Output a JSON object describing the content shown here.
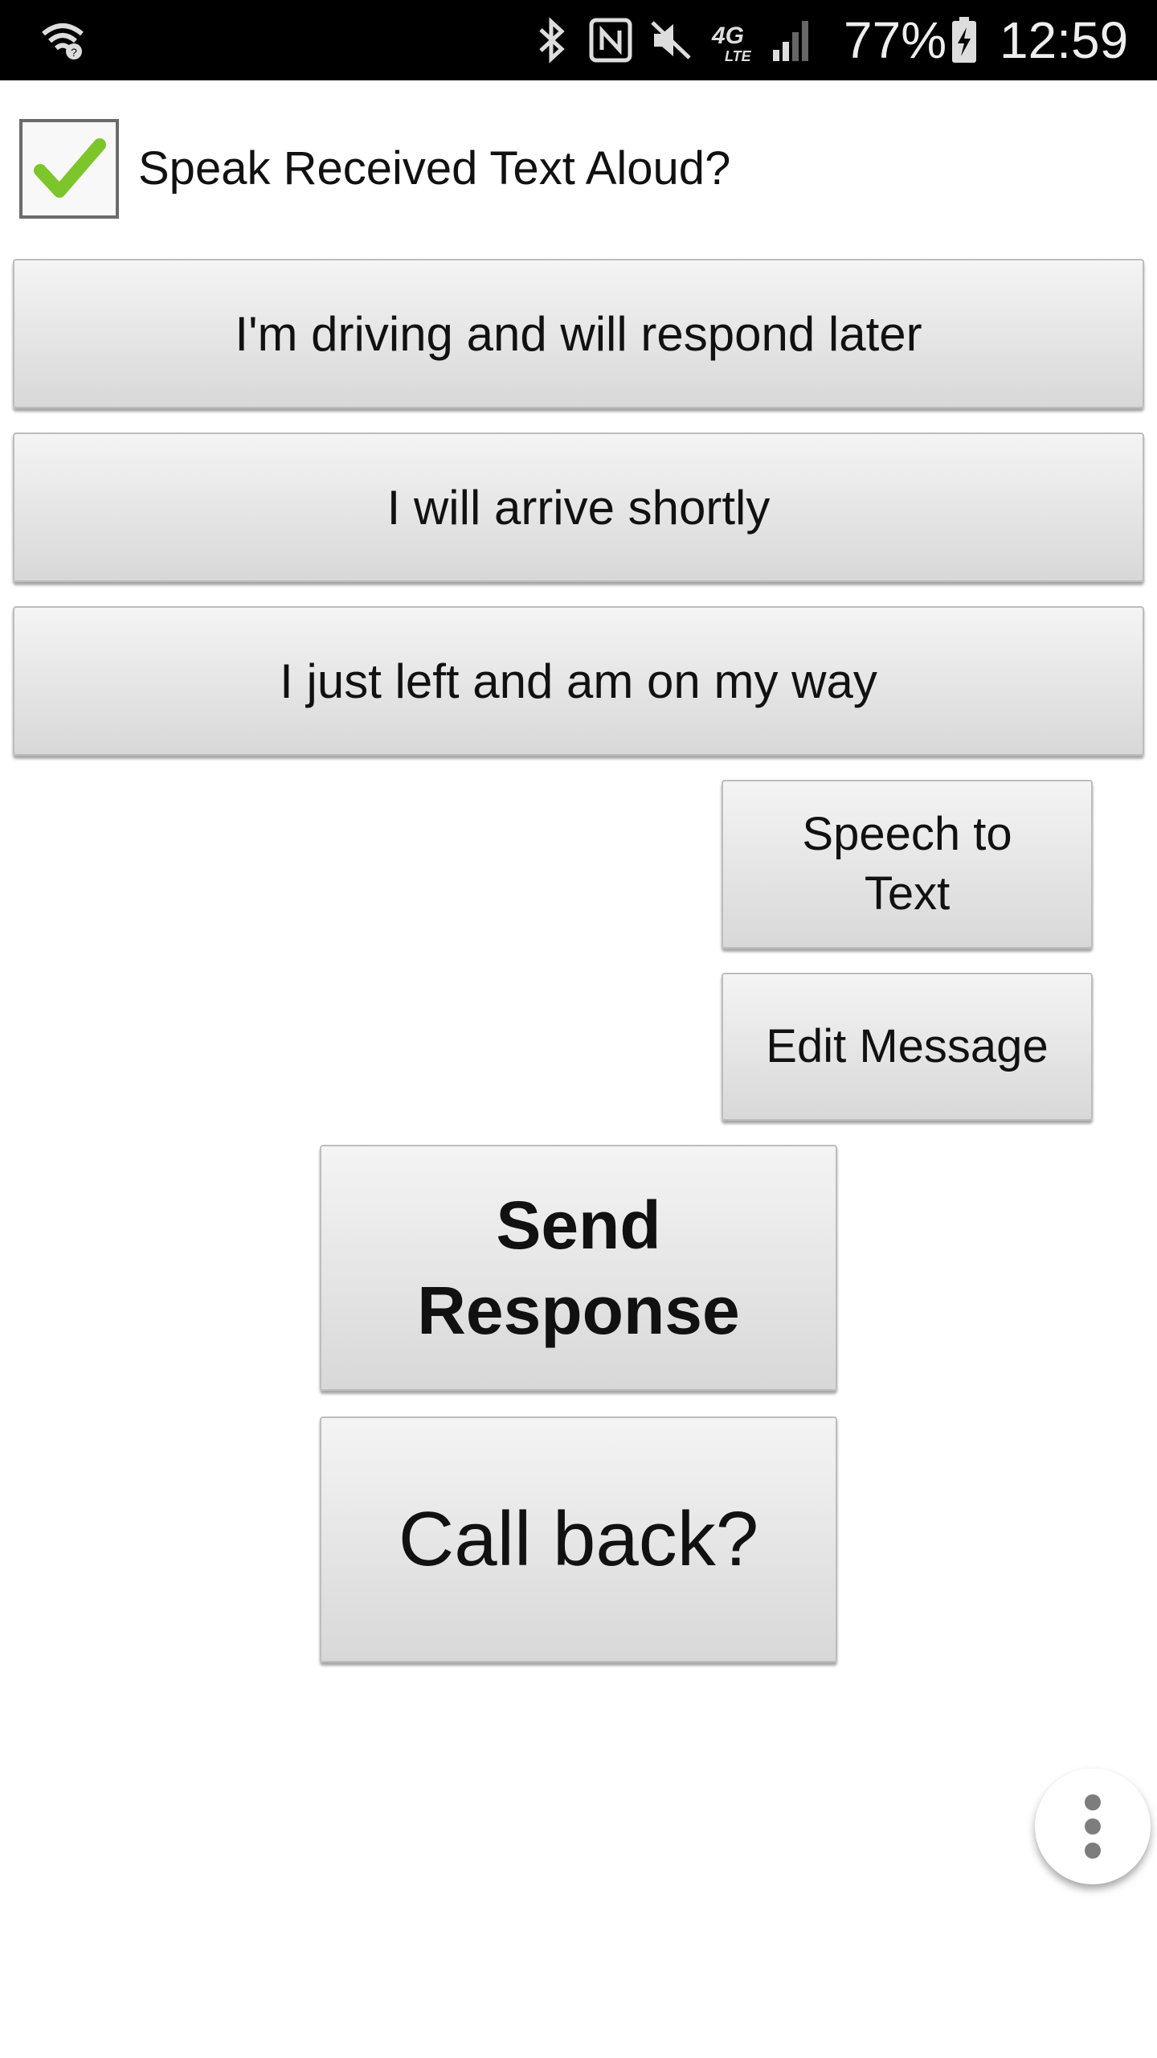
{
  "status_bar": {
    "icons": [
      "wifi-calling-icon",
      "bluetooth-icon",
      "nfc-icon",
      "mute-icon",
      "4g-lte-icon",
      "signal-icon",
      "battery-charging-icon"
    ],
    "battery_percent": "77%",
    "time": "12:59",
    "network_label": "4G",
    "network_sub": "LTE"
  },
  "settings": {
    "speak_aloud_label": "Speak Received Text Aloud?",
    "speak_aloud_checked": true
  },
  "quick_replies": [
    {
      "label": "I'm driving and will respond later"
    },
    {
      "label": "I will arrive shortly"
    },
    {
      "label": "I just left and am on my way"
    }
  ],
  "actions": {
    "speech_to_text_line1": "Speech to",
    "speech_to_text_line2": "Text",
    "edit_message": "Edit Message",
    "send_response_line1": "Send",
    "send_response_line2": "Response",
    "call_back": "Call back?"
  },
  "colors": {
    "check": "#7cc62c",
    "status_bar_bg": "#000000",
    "button_top": "#f4f4f4",
    "button_bottom": "#d8d8d8"
  }
}
